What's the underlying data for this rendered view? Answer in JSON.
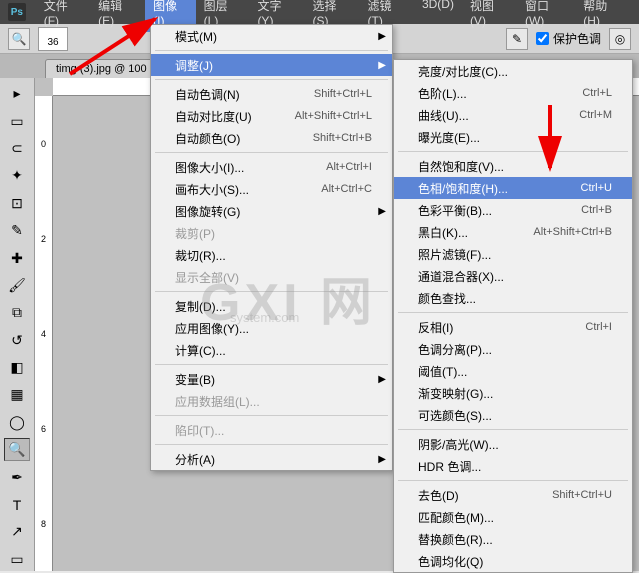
{
  "menubar": {
    "items": [
      "文件(F)",
      "编辑(E)",
      "图像(I)",
      "图层(L)",
      "文字(Y)",
      "选择(S)",
      "滤镜(T)",
      "3D(D)",
      "视图(V)",
      "窗口(W)",
      "帮助(H)"
    ],
    "active_index": 2
  },
  "optbar": {
    "brush_size": "36",
    "protect": "保护色调"
  },
  "tab": {
    "label": "timg (3).jpg @ 100"
  },
  "ruler_v": [
    "0",
    "2",
    "4",
    "6",
    "8"
  ],
  "dropdown1": {
    "groups": [
      [
        {
          "label": "模式(M)",
          "shortcut": "",
          "arrow": true
        }
      ],
      [
        {
          "label": "调整(J)",
          "shortcut": "",
          "arrow": true,
          "hov": true
        }
      ],
      [
        {
          "label": "自动色调(N)",
          "shortcut": "Shift+Ctrl+L"
        },
        {
          "label": "自动对比度(U)",
          "shortcut": "Alt+Shift+Ctrl+L"
        },
        {
          "label": "自动颜色(O)",
          "shortcut": "Shift+Ctrl+B"
        }
      ],
      [
        {
          "label": "图像大小(I)...",
          "shortcut": "Alt+Ctrl+I"
        },
        {
          "label": "画布大小(S)...",
          "shortcut": "Alt+Ctrl+C"
        },
        {
          "label": "图像旋转(G)",
          "shortcut": "",
          "arrow": true
        },
        {
          "label": "裁剪(P)",
          "shortcut": "",
          "disabled": true
        },
        {
          "label": "裁切(R)...",
          "shortcut": ""
        },
        {
          "label": "显示全部(V)",
          "shortcut": "",
          "disabled": true
        }
      ],
      [
        {
          "label": "复制(D)...",
          "shortcut": ""
        },
        {
          "label": "应用图像(Y)...",
          "shortcut": ""
        },
        {
          "label": "计算(C)...",
          "shortcut": ""
        }
      ],
      [
        {
          "label": "变量(B)",
          "shortcut": "",
          "arrow": true
        },
        {
          "label": "应用数据组(L)...",
          "shortcut": "",
          "disabled": true
        }
      ],
      [
        {
          "label": "陷印(T)...",
          "shortcut": "",
          "disabled": true
        }
      ],
      [
        {
          "label": "分析(A)",
          "shortcut": "",
          "arrow": true
        }
      ]
    ]
  },
  "dropdown2": {
    "groups": [
      [
        {
          "label": "亮度/对比度(C)...",
          "shortcut": ""
        },
        {
          "label": "色阶(L)...",
          "shortcut": "Ctrl+L"
        },
        {
          "label": "曲线(U)...",
          "shortcut": "Ctrl+M"
        },
        {
          "label": "曝光度(E)...",
          "shortcut": ""
        }
      ],
      [
        {
          "label": "自然饱和度(V)...",
          "shortcut": ""
        },
        {
          "label": "色相/饱和度(H)...",
          "shortcut": "Ctrl+U",
          "hov": true
        },
        {
          "label": "色彩平衡(B)...",
          "shortcut": "Ctrl+B"
        },
        {
          "label": "黑白(K)...",
          "shortcut": "Alt+Shift+Ctrl+B"
        },
        {
          "label": "照片滤镜(F)...",
          "shortcut": ""
        },
        {
          "label": "通道混合器(X)...",
          "shortcut": ""
        },
        {
          "label": "颜色查找...",
          "shortcut": ""
        }
      ],
      [
        {
          "label": "反相(I)",
          "shortcut": "Ctrl+I"
        },
        {
          "label": "色调分离(P)...",
          "shortcut": ""
        },
        {
          "label": "阈值(T)...",
          "shortcut": ""
        },
        {
          "label": "渐变映射(G)...",
          "shortcut": ""
        },
        {
          "label": "可选颜色(S)...",
          "shortcut": ""
        }
      ],
      [
        {
          "label": "阴影/高光(W)...",
          "shortcut": ""
        },
        {
          "label": "HDR 色调...",
          "shortcut": ""
        }
      ],
      [
        {
          "label": "去色(D)",
          "shortcut": "Shift+Ctrl+U"
        },
        {
          "label": "匹配颜色(M)...",
          "shortcut": ""
        },
        {
          "label": "替换颜色(R)...",
          "shortcut": ""
        },
        {
          "label": "色调均化(Q)",
          "shortcut": ""
        }
      ]
    ]
  },
  "watermark": {
    "main": "GXI 网",
    "sub": "system.com"
  }
}
